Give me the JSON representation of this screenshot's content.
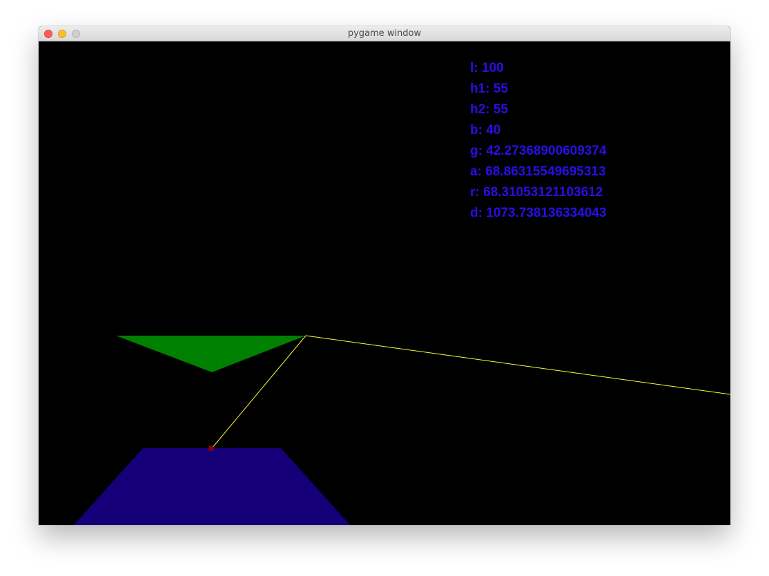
{
  "window": {
    "title": "pygame window"
  },
  "colors": {
    "background": "#000000",
    "text": "#2a0ee6",
    "top_triangle": "#008000",
    "base_trapezoid": "#15007a",
    "ray": "#ffff33",
    "pivot": "#8b0000"
  },
  "readout": [
    {
      "key": "l",
      "text": "l: 100"
    },
    {
      "key": "h1",
      "text": "h1: 55"
    },
    {
      "key": "h2",
      "text": "h2: 55"
    },
    {
      "key": "b",
      "text": "b: 40"
    },
    {
      "key": "g",
      "text": "g: 42.27368900609374"
    },
    {
      "key": "a",
      "text": "a: 68.86315549695313"
    },
    {
      "key": "r",
      "text": "r: 68.31053121103612"
    },
    {
      "key": "d",
      "text": "d: 1073.738136334043"
    }
  ]
}
